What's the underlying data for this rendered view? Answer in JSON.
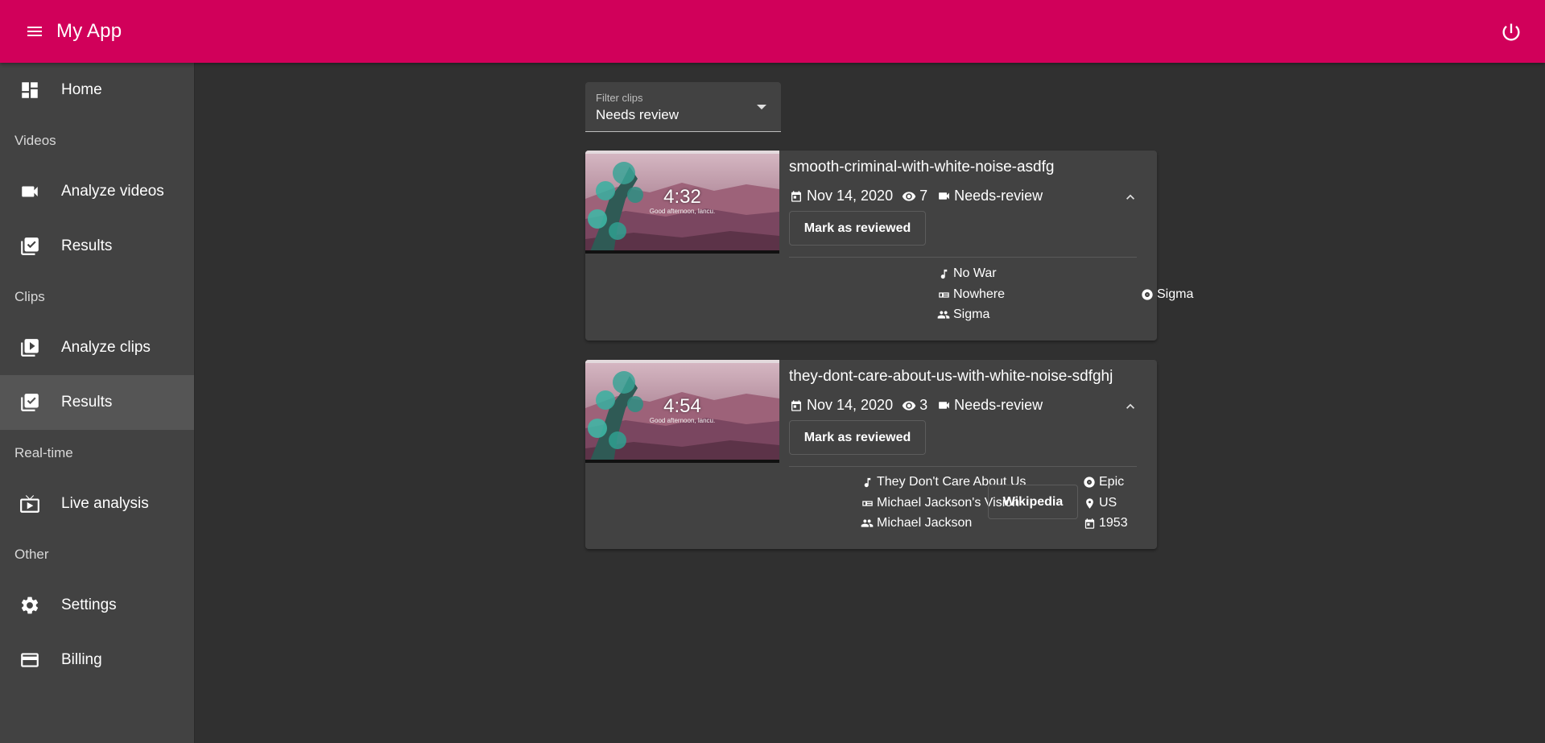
{
  "app": {
    "title": "My App"
  },
  "colors": {
    "primary": "#d1005a",
    "background": "#303030",
    "surface": "#424242",
    "active_nav": "#555555"
  },
  "sidebar": {
    "home": {
      "label": "Home",
      "icon": "dashboard-icon"
    },
    "videos_section": "Videos",
    "analyze_videos": {
      "label": "Analyze videos",
      "icon": "videocam-icon"
    },
    "video_results": {
      "label": "Results",
      "icon": "library-add-check-icon"
    },
    "clips_section": "Clips",
    "analyze_clips": {
      "label": "Analyze clips",
      "icon": "video-library-icon"
    },
    "clip_results": {
      "label": "Results",
      "icon": "library-add-check-icon",
      "active": true
    },
    "realtime_section": "Real-time",
    "live_analysis": {
      "label": "Live analysis",
      "icon": "live-tv-icon"
    },
    "other_section": "Other",
    "settings": {
      "label": "Settings",
      "icon": "gear-icon"
    },
    "billing": {
      "label": "Billing",
      "icon": "credit-card-icon"
    }
  },
  "filter": {
    "label": "Filter clips",
    "value": "Needs review"
  },
  "clips": [
    {
      "title": "smooth-criminal-with-white-noise-asdfg",
      "thumbnail": {
        "time": "4:32",
        "greeting": "Good afternoon, lancu."
      },
      "date": "Nov 14, 2020",
      "views": "7",
      "status": "Needs-review",
      "mark_label": "Mark as reviewed",
      "song": "No War",
      "album": "Nowhere",
      "artist": "Sigma",
      "label": "Sigma"
    },
    {
      "title": "they-dont-care-about-us-with-white-noise-sdfghj",
      "thumbnail": {
        "time": "4:54",
        "greeting": "Good afternoon, lancu."
      },
      "date": "Nov 14, 2020",
      "views": "3",
      "status": "Needs-review",
      "mark_label": "Mark as reviewed",
      "song": "They Don't Care About Us",
      "album": "Michael Jackson's Vision",
      "artist": "Michael Jackson",
      "label": "Epic",
      "country": "US",
      "year": "1953",
      "wiki_label": "Wikipedia"
    }
  ]
}
